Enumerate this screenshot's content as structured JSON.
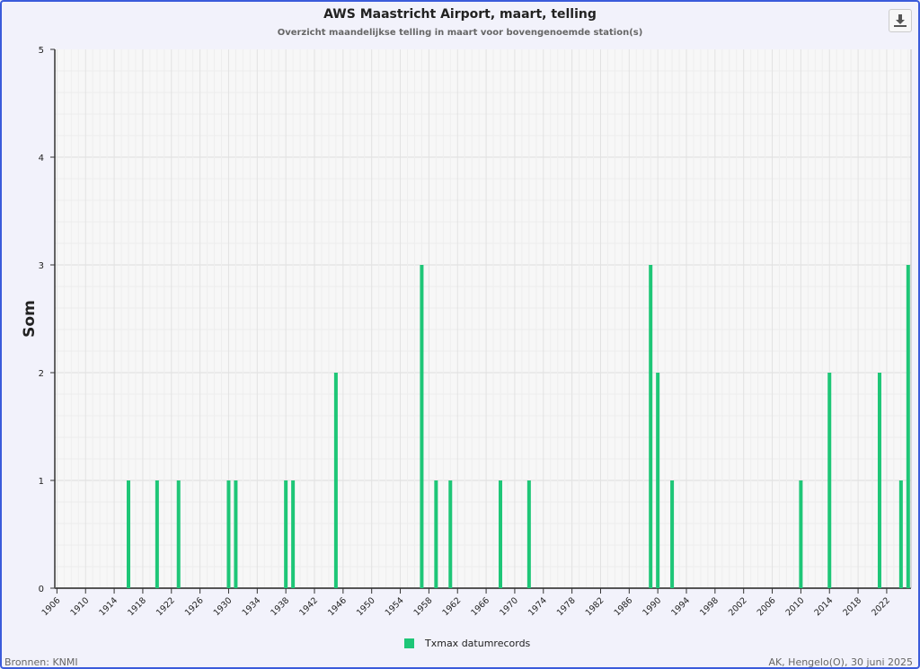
{
  "chart_data": {
    "type": "bar",
    "title": "AWS Maastricht Airport, maart, telling",
    "subtitle": "Overzicht maandelijkse telling in maart voor bovengenoemde station(s)",
    "xlabel": "",
    "ylabel": "Som",
    "xlim": [
      1905.7,
      2025.4
    ],
    "ylim": [
      0,
      5
    ],
    "yticks": [
      0,
      1,
      2,
      3,
      4,
      5
    ],
    "xticks": [
      1906,
      1910,
      1914,
      1918,
      1922,
      1926,
      1930,
      1934,
      1938,
      1942,
      1946,
      1950,
      1954,
      1958,
      1962,
      1966,
      1970,
      1974,
      1978,
      1982,
      1986,
      1990,
      1994,
      1998,
      2002,
      2006,
      2010,
      2014,
      2018,
      2022
    ],
    "grid": true,
    "legend_position": "bottom",
    "series": [
      {
        "name": "Txmax datumrecords",
        "color": "#1ec677",
        "x": [
          1916,
          1920,
          1923,
          1930,
          1931,
          1938,
          1939,
          1945,
          1957,
          1959,
          1961,
          1968,
          1972,
          1989,
          1990,
          1992,
          2010,
          2014,
          2021,
          2024,
          2025
        ],
        "values": [
          1,
          1,
          1,
          1,
          1,
          1,
          1,
          2,
          3,
          1,
          1,
          1,
          1,
          3,
          2,
          1,
          1,
          2,
          2,
          1,
          3
        ]
      }
    ]
  },
  "footer": {
    "source": "Bronnen: KNMI",
    "credit": "AK, Hengelo(O), 30 juni 2025"
  },
  "icons": {
    "download": "download-icon"
  }
}
